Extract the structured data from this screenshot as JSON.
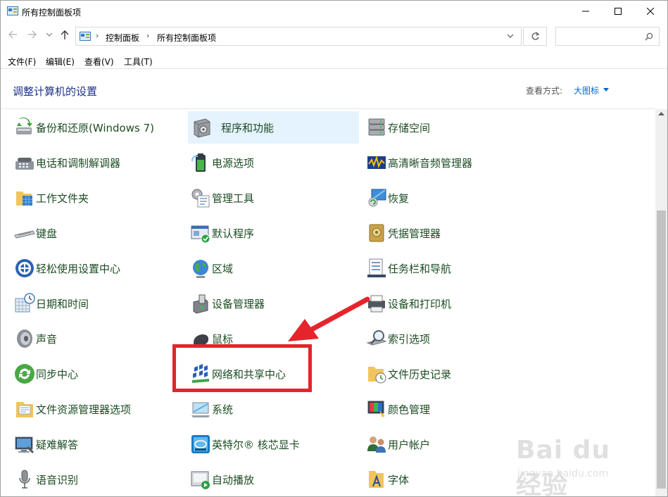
{
  "window": {
    "title": "所有控制面板项"
  },
  "address_bar": {
    "breadcrumbs": [
      "控制面板",
      "所有控制面板项"
    ],
    "separator": "›",
    "search_placeholder": ""
  },
  "menu": [
    "文件(F)",
    "编辑(E)",
    "查看(V)",
    "工具(T)"
  ],
  "header": {
    "title": "调整计算机的设置",
    "view_by_label": "查看方式:",
    "view_by_value": "大图标"
  },
  "items": {
    "col1": [
      {
        "label": "备份和还原(Windows 7)",
        "icon": "backup-restore-icon"
      },
      {
        "label": "电话和调制解调器",
        "icon": "phone-modem-icon"
      },
      {
        "label": "工作文件夹",
        "icon": "work-folders-icon"
      },
      {
        "label": "键盘",
        "icon": "keyboard-icon"
      },
      {
        "label": "轻松使用设置中心",
        "icon": "ease-of-access-icon"
      },
      {
        "label": "日期和时间",
        "icon": "date-time-icon"
      },
      {
        "label": "声音",
        "icon": "sound-icon"
      },
      {
        "label": "同步中心",
        "icon": "sync-center-icon"
      },
      {
        "label": "文件资源管理器选项",
        "icon": "explorer-options-icon"
      },
      {
        "label": "疑难解答",
        "icon": "troubleshooting-icon"
      },
      {
        "label": "语音识别",
        "icon": "speech-recognition-icon"
      }
    ],
    "col2": [
      {
        "label": "程序和功能",
        "icon": "programs-features-icon"
      },
      {
        "label": "电源选项",
        "icon": "power-options-icon"
      },
      {
        "label": "管理工具",
        "icon": "admin-tools-icon"
      },
      {
        "label": "默认程序",
        "icon": "default-programs-icon"
      },
      {
        "label": "区域",
        "icon": "region-icon"
      },
      {
        "label": "设备管理器",
        "icon": "device-manager-icon"
      },
      {
        "label": "鼠标",
        "icon": "mouse-icon"
      },
      {
        "label": "网络和共享中心",
        "icon": "network-sharing-icon"
      },
      {
        "label": "系统",
        "icon": "system-icon"
      },
      {
        "label": "英特尔® 核芯显卡",
        "icon": "intel-graphics-icon"
      },
      {
        "label": "自动播放",
        "icon": "autoplay-icon"
      }
    ],
    "col3": [
      {
        "label": "存储空间",
        "icon": "storage-spaces-icon"
      },
      {
        "label": "高清晰音频管理器",
        "icon": "hd-audio-icon"
      },
      {
        "label": "恢复",
        "icon": "recovery-icon"
      },
      {
        "label": "凭据管理器",
        "icon": "credential-manager-icon"
      },
      {
        "label": "任务栏和导航",
        "icon": "taskbar-navigation-icon"
      },
      {
        "label": "设备和打印机",
        "icon": "devices-printers-icon"
      },
      {
        "label": "索引选项",
        "icon": "indexing-options-icon"
      },
      {
        "label": "文件历史记录",
        "icon": "file-history-icon"
      },
      {
        "label": "颜色管理",
        "icon": "color-management-icon"
      },
      {
        "label": "用户帐户",
        "icon": "user-accounts-icon"
      },
      {
        "label": "字体",
        "icon": "fonts-icon"
      }
    ]
  },
  "hovered_item": "程序和功能",
  "highlighted_item": "网络和共享中心",
  "annotation_color": "#e5242b",
  "watermark": {
    "brand": "Bai du 经验",
    "url": "jingyan.baidu.com"
  }
}
